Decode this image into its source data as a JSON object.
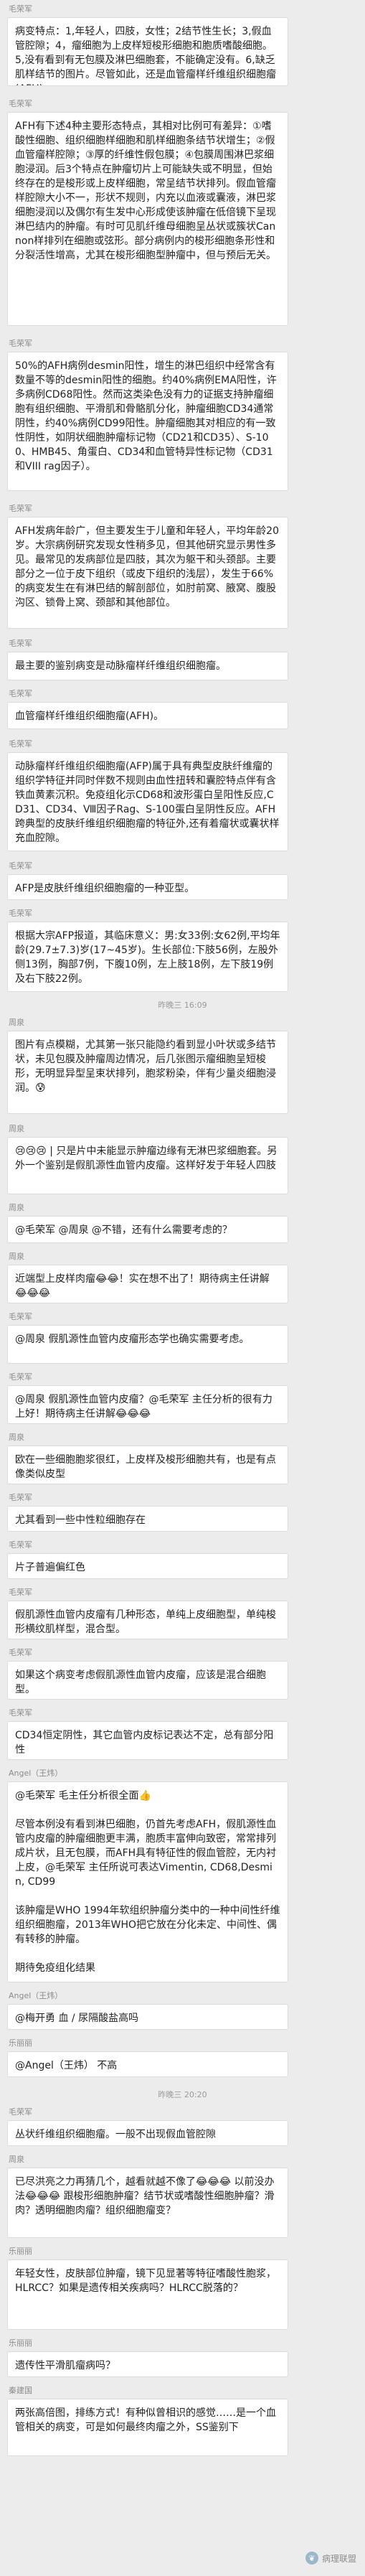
{
  "messages": [
    {
      "sender": "毛荣军",
      "text": "病变特点：1,年轻人，四肢，女性；2结节性生长；3,假血管腔隙；4，瘤细胞为上皮样短梭形细胞和胞质嗜酸细胞。5,没有看到有无包膜及淋巴细胞套，不能确定没有。6,缺乏肌样结节的图片。尽管如此，还是血管瘤样纤维组织细胞瘤(AFH)。"
    },
    {
      "sender": "毛荣军",
      "text": "AFH有下述4种主要形态特点，其相对比例可有差异：①嗜酸性细胞、组织细胞样细胞和肌样细胞条结节状增生；②假血管瘤样腔隙；③厚的纤维性假包膜；④包膜周围淋巴浆细胞浸润。后3个特点在肿瘤切片上可能缺失或不明显，但始终存在的是梭形或上皮样细胞，常呈结节状排列。假血管瘤样腔隙大小不一，形状不规则，内充以血液或囊液，淋巴浆细胞浸润以及偶尔有生发中心形成使该肿瘤在低倍镜下呈现淋巴结内的肿瘤。有时可见肌纤维母细胞呈丛状或簇状Cannon样排列在细胞或弦形。部分病例内的梭形细胞条形性和分裂活性增高，尤其在梭形细胞型肿瘤中，但与预后无关。"
    },
    {
      "sender": "毛荣军",
      "text": "50%的AFH病例desmin阳性，增生的淋巴组织中经常含有数量不等的desmin阳性的细胞。约40%病例EMA阳性，许多病例CD68阳性。然而这类染色没有力的证据支持肿瘤细胞有组织细胞、平滑肌和骨骼肌分化，肿瘤细胞CD34通常阴性，约40%病例CD99阳性。肿瘤细胞其对相应的有一致性阴性，如阴状细胞肿瘤标记物（CD21和CD35）、S-100、HMB45、角蛋白、CD34和血管特异性标记物（CD31和VIII rag因子）。"
    },
    {
      "sender": "毛荣军",
      "text": "AFH发病年龄广，但主要发生于儿童和年轻人，平均年龄20岁。大宗病例研究发现女性稍多见，但其他研究显示男性多见。最常见的发病部位是四肢，其次为躯干和头颈部。主要部分之一位于皮下组织（或皮下组织的浅层），发生于66%的病变发生在有淋巴结的解剖部位，如肘前窝、腋窝、腹股沟区、锁骨上窝、颈部和其他部位。"
    },
    {
      "sender": "毛荣军",
      "text": "最主要的鉴别病变是动脉瘤样纤维组织细胞瘤。"
    },
    {
      "sender": "毛荣军",
      "text": "血管瘤样纤维组织细胞瘤(AFH)。"
    },
    {
      "sender": "毛荣军",
      "text": "动脉瘤样纤维组织细胞瘤(AFP)属于具有典型皮肤纤维瘤的组织学特征并同时伴数不规则由血性扭转和囊腔特点伴有含铁血黄素沉积。免疫组化示CD68和波形蛋白呈阳性反应,CD31、CD34、Ⅷ因子Rag、S-100蛋白呈阴性反应。AFH跨典型的皮肤纤维组织细胞瘤的特征外,还有着瘤状或囊状样充血腔隙。"
    },
    {
      "sender": "毛荣军",
      "text": "AFP是皮肤纤维组织细胞瘤的一种亚型。"
    },
    {
      "sender": "毛荣军",
      "text": "根据大宗AFP报道，其临床意义：男:女33例:女62例,平均年龄(29.7±7.3)岁(17~45岁)。生长部位:下肢56例，左股外侧13例，胸部7例，下腹10例，左上肢18例，左下肢19例及右下肢22例。"
    },
    {
      "sender": "周泉",
      "text": "图片有点模糊，尤其第一张只能隐约看到显小叶状或多结节状，未见包膜及肿瘤周边情况，后几张图示瘤细胞呈短梭形，无明显异型呈束状排列，胞浆粉染，伴有少量炎细胞浸润。😰"
    },
    {
      "sender": "周泉",
      "text": "😢😢😢 | 只是片中未能显示肿瘤边缘有无淋巴浆细胞套。另外一个鉴别是假肌源性血管内皮瘤。这样好发于年轻人四肢"
    },
    {
      "sender": "周泉",
      "text": "@毛荣军 @周泉 @不错，还有什么需要考虑的？"
    },
    {
      "sender": "周泉",
      "text": "近端型上皮样肉瘤😂😂！实在想不出了！期待病主任讲解😂😂😂"
    },
    {
      "sender": "毛荣军",
      "text": "@周泉 假肌源性血管内皮瘤形态学也确实需要考虑。"
    },
    {
      "sender": "毛荣军",
      "text": "@周泉 假肌源性血管内皮瘤？@毛荣军 主任分析的很有力上好！期待病主任讲解😂😂😂"
    },
    {
      "sender": "周泉",
      "text": "欧在一些细胞胞浆很红，上皮样及梭形细胞共有，也是有点像类似皮型"
    },
    {
      "sender": "毛荣军",
      "text": "尤其看到一些中性粒细胞存在"
    },
    {
      "sender": "毛荣军",
      "text": "片子普遍偏红色"
    },
    {
      "sender": "毛荣军",
      "text": "假肌源性血管内皮瘤有几种形态，单纯上皮细胞型，单纯梭形横纹肌样型，混合型。"
    },
    {
      "sender": "毛荣军",
      "text": "如果这个病变考虑假肌源性血管内皮瘤，应该是混合细胞型。"
    },
    {
      "sender": "毛荣军",
      "text": "CD34恒定阴性，其它血管内皮标记表达不定，总有部分阳性"
    },
    {
      "sender": "Angel（王炜）",
      "text": "@毛荣军 毛主任分析很全面👍\n\n尽管本例没有看到淋巴细胞，仍首先考虑AFH，假肌源性血管内皮瘤的肿瘤细胞更丰满，胞质丰富伸向致密，常常排列成片状，且无包膜，而AFH具有特征性的假血管腔，无内衬上皮，@毛荣军 主任所说可表达Vimentin, CD68,Desmin, CD99\n\n该肿瘤是WHO 1994年软组织肿瘤分类中的一种中间性纤维组织细胞瘤，2013年WHO把它放在分化未定、中间性、偶有转移的肿瘤。\n\n期待免疫组化结果"
    },
    {
      "sender": "Angel（王炜）",
      "text": "@梅开勇 血 / 尿隔酸盐高吗"
    },
    {
      "sender": "乐丽丽",
      "text": "@Angel（王炜） 不高"
    },
    {
      "sender": "毛荣军",
      "text": "丛状纤维组织细胞瘤。一般不出现假血管腔隙"
    },
    {
      "sender": "周泉",
      "text": "已尽洪亮之力再猜几个，越看就越不像了😂😂😂 以前没办法😂😂😂 跟梭形细胞肿瘤？结节状或嗜酸性细胞肿瘤？滑肉？透明细胞肉瘤？组织细胞瘤变？"
    },
    {
      "sender": "乐丽丽",
      "text": "年轻女性，皮肤部位肿瘤，镜下见显著等特征嗜酸性胞浆，HLRCC？如果是遗传相关疾病吗？HLRCC脱落的？"
    },
    {
      "sender": "乐丽丽",
      "text": "遗传性平滑肌瘤病吗？"
    },
    {
      "sender": "秦建国",
      "text": "两张高倍图，排练方式！有种似曾相识的感觉……是一个血管相关的病变，可是如何最终肉瘤之外，SS鉴别下"
    }
  ],
  "timestamps": [
    "昨晚三 16:09",
    "昨晚三 20:20"
  ],
  "watermark": {
    "text": "病理联盟",
    "logo_icon": "leaf-icon"
  }
}
